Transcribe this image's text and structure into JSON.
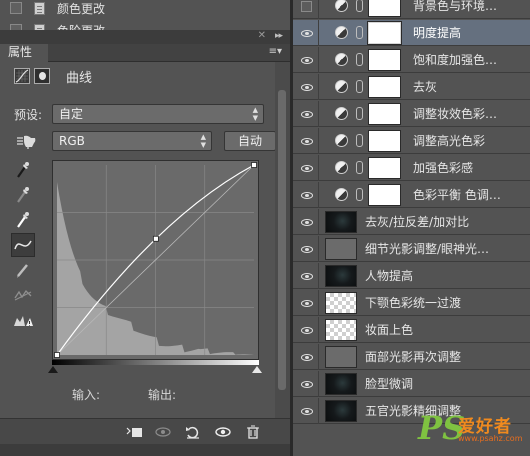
{
  "history": {
    "items": [
      {
        "label": "颜色更改"
      },
      {
        "label": "色阶更改"
      }
    ]
  },
  "properties": {
    "tab_label": "属性",
    "menu_icon": "panel-menu-icon",
    "type_label": "曲线",
    "preset_label": "预设:",
    "preset_value": "自定",
    "channel_value": "RGB",
    "auto_label": "自动",
    "input_label": "输入:",
    "output_label": "输出:",
    "tools": [
      "on-image-adjust-icon",
      "black-point-eyedropper-icon",
      "gray-point-eyedropper-icon",
      "white-point-eyedropper-icon",
      "edit-points-icon",
      "pencil-draw-icon",
      "smooth-icon",
      "clipping-warning-icon"
    ],
    "bottom_icons": [
      "clip-to-layer-icon",
      "view-previous-icon",
      "reset-icon",
      "visibility-icon",
      "delete-icon"
    ]
  },
  "curve": {
    "points": [
      [
        0,
        0
      ],
      [
        128,
        156
      ],
      [
        255,
        255
      ]
    ],
    "grid_divisions": 4,
    "histogram_color": "#a4a4a4"
  },
  "layers": [
    {
      "name": "背景色与环境…",
      "type": "adjustment",
      "visible": false,
      "selected": false
    },
    {
      "name": "明度提高",
      "type": "adjustment",
      "visible": true,
      "selected": true
    },
    {
      "name": "饱和度加强色…",
      "type": "adjustment",
      "visible": true,
      "selected": false
    },
    {
      "name": "去灰",
      "type": "adjustment",
      "visible": true,
      "selected": false
    },
    {
      "name": "调整妆效色彩…",
      "type": "adjustment",
      "visible": true,
      "selected": false
    },
    {
      "name": "调整高光色彩",
      "type": "adjustment",
      "visible": true,
      "selected": false
    },
    {
      "name": "加强色彩感",
      "type": "adjustment",
      "visible": true,
      "selected": false
    },
    {
      "name": "色彩平衡 色调…",
      "type": "adjustment",
      "visible": true,
      "selected": false
    },
    {
      "name": "去灰/拉反差/加对比",
      "type": "pixel",
      "thumb": "dark",
      "visible": true,
      "selected": false
    },
    {
      "name": "细节光影调整/眼神光…",
      "type": "pixel",
      "thumb": "gray",
      "visible": true,
      "selected": false
    },
    {
      "name": "人物提高",
      "type": "pixel",
      "thumb": "dark",
      "visible": true,
      "selected": false
    },
    {
      "name": "下颚色彩统一过渡",
      "type": "pixel",
      "thumb": "checker",
      "visible": true,
      "selected": false
    },
    {
      "name": "妆面上色",
      "type": "pixel",
      "thumb": "checker",
      "visible": true,
      "selected": false
    },
    {
      "name": "面部光影再次调整",
      "type": "pixel",
      "thumb": "gray",
      "visible": true,
      "selected": false
    },
    {
      "name": "脸型微调",
      "type": "pixel",
      "thumb": "dark",
      "visible": true,
      "selected": false
    },
    {
      "name": "五官光影精细调整",
      "type": "pixel",
      "thumb": "dark",
      "visible": true,
      "selected": false
    }
  ],
  "watermark": {
    "logo": "PS",
    "site_cn": "爱好者",
    "url": "www.psahz.com"
  },
  "colors": {
    "panel_bg": "#535353",
    "selected_layer": "#65707f",
    "curve_bg": "#6a6a6a",
    "watermark_green": "#7fc241",
    "watermark_orange": "#f08a1e"
  }
}
